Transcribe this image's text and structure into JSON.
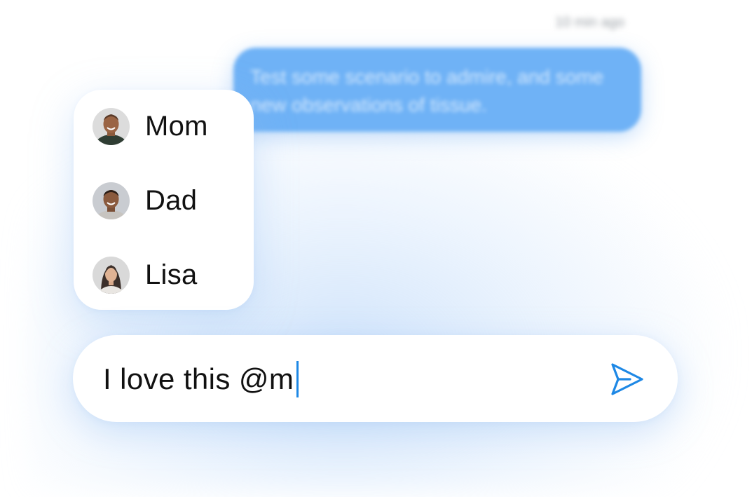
{
  "background_message": {
    "timestamp": "10 min ago",
    "text": "Test some scenario to admire, and some new observations of tissue."
  },
  "mention_menu": {
    "items": [
      {
        "label": "Mom",
        "avatar": "avatar-mom"
      },
      {
        "label": "Dad",
        "avatar": "avatar-dad"
      },
      {
        "label": "Lisa",
        "avatar": "avatar-lisa"
      }
    ]
  },
  "composer": {
    "value": "I love this @m",
    "send_icon": "send-icon"
  },
  "colors": {
    "accent": "#1e88e5",
    "bubble": "#6fb2f6"
  }
}
